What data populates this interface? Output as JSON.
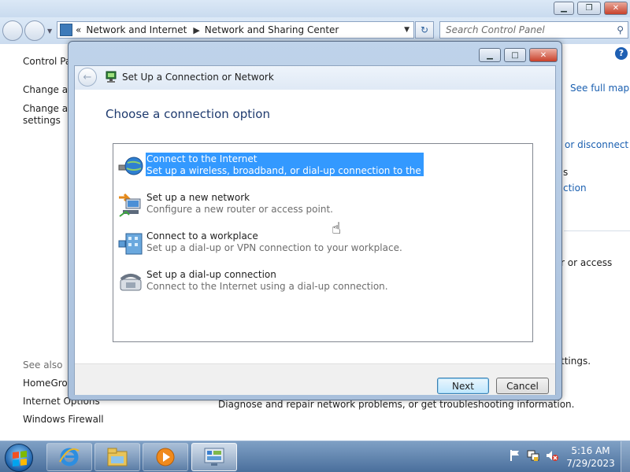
{
  "background_window": {
    "breadcrumb": {
      "overflow": "«",
      "items": [
        "Network and Internet",
        "Network and Sharing Center"
      ]
    },
    "search_placeholder": "Search Control Panel",
    "left_pane": {
      "control_panel_home": "Control Pa",
      "change_adapter_line": "Change ad",
      "change_advanced_line1": "Change ad",
      "change_advanced_line2": "settings",
      "see_also_label": "See also",
      "see_also_items": [
        "HomeGrou",
        "Internet Options",
        "Windows Firewall"
      ]
    },
    "right_fragments": {
      "see_full_map": "See full map",
      "connect_or_disconnect": "or disconnect",
      "fragment_s": "s",
      "fragment_ction": "ction",
      "fragment_or_access": "r or access",
      "fragment_ttings": "ttings."
    },
    "troubleshoot_text": "Diagnose and repair network problems, or get troubleshooting information."
  },
  "dialog": {
    "title": "Set Up a Connection or Network",
    "heading": "Choose a connection option",
    "options": [
      {
        "title": "Connect to the Internet",
        "description": "Set up a wireless, broadband, or dial-up connection to the Internet.",
        "icon": "globe-network-icon",
        "selected": true
      },
      {
        "title": "Set up a new network",
        "description": "Configure a new router or access point.",
        "icon": "new-network-icon",
        "selected": false
      },
      {
        "title": "Connect to a workplace",
        "description": "Set up a dial-up or VPN connection to your workplace.",
        "icon": "workplace-building-icon",
        "selected": false
      },
      {
        "title": "Set up a dial-up connection",
        "description": "Connect to the Internet using a dial-up connection.",
        "icon": "telephone-modem-icon",
        "selected": false
      }
    ],
    "buttons": {
      "next": "Next",
      "cancel": "Cancel"
    }
  },
  "taskbar": {
    "pinned": [
      "internet-explorer-icon",
      "windows-explorer-icon",
      "media-player-icon",
      "control-panel-icon"
    ],
    "active_item": "control-panel-icon",
    "clock": {
      "time": "5:16 AM",
      "date": "7/29/2023"
    }
  },
  "colors": {
    "selection": "#3399ff",
    "link": "#1a5fb0",
    "heading": "#1e3a6e",
    "taskbar": "#4a6f9c"
  }
}
